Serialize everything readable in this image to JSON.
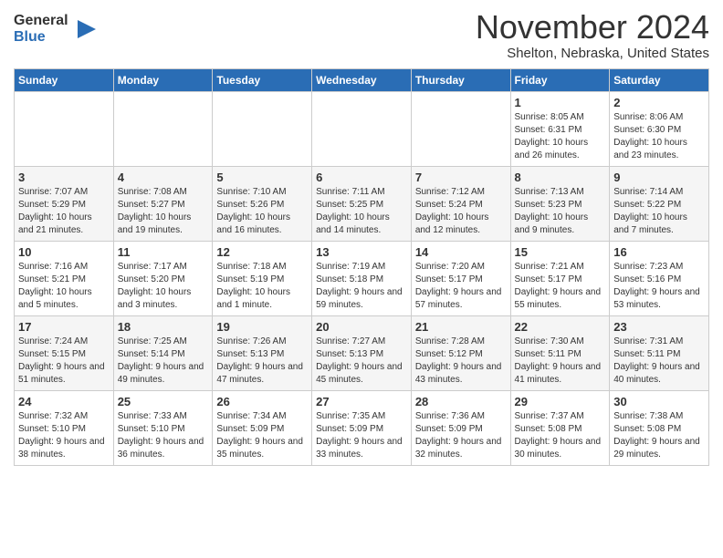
{
  "header": {
    "logo_general": "General",
    "logo_blue": "Blue",
    "month_title": "November 2024",
    "location": "Shelton, Nebraska, United States"
  },
  "days_of_week": [
    "Sunday",
    "Monday",
    "Tuesday",
    "Wednesday",
    "Thursday",
    "Friday",
    "Saturday"
  ],
  "weeks": [
    [
      {
        "day": "",
        "info": ""
      },
      {
        "day": "",
        "info": ""
      },
      {
        "day": "",
        "info": ""
      },
      {
        "day": "",
        "info": ""
      },
      {
        "day": "",
        "info": ""
      },
      {
        "day": "1",
        "info": "Sunrise: 8:05 AM\nSunset: 6:31 PM\nDaylight: 10 hours and 26 minutes."
      },
      {
        "day": "2",
        "info": "Sunrise: 8:06 AM\nSunset: 6:30 PM\nDaylight: 10 hours and 23 minutes."
      }
    ],
    [
      {
        "day": "3",
        "info": "Sunrise: 7:07 AM\nSunset: 5:29 PM\nDaylight: 10 hours and 21 minutes."
      },
      {
        "day": "4",
        "info": "Sunrise: 7:08 AM\nSunset: 5:27 PM\nDaylight: 10 hours and 19 minutes."
      },
      {
        "day": "5",
        "info": "Sunrise: 7:10 AM\nSunset: 5:26 PM\nDaylight: 10 hours and 16 minutes."
      },
      {
        "day": "6",
        "info": "Sunrise: 7:11 AM\nSunset: 5:25 PM\nDaylight: 10 hours and 14 minutes."
      },
      {
        "day": "7",
        "info": "Sunrise: 7:12 AM\nSunset: 5:24 PM\nDaylight: 10 hours and 12 minutes."
      },
      {
        "day": "8",
        "info": "Sunrise: 7:13 AM\nSunset: 5:23 PM\nDaylight: 10 hours and 9 minutes."
      },
      {
        "day": "9",
        "info": "Sunrise: 7:14 AM\nSunset: 5:22 PM\nDaylight: 10 hours and 7 minutes."
      }
    ],
    [
      {
        "day": "10",
        "info": "Sunrise: 7:16 AM\nSunset: 5:21 PM\nDaylight: 10 hours and 5 minutes."
      },
      {
        "day": "11",
        "info": "Sunrise: 7:17 AM\nSunset: 5:20 PM\nDaylight: 10 hours and 3 minutes."
      },
      {
        "day": "12",
        "info": "Sunrise: 7:18 AM\nSunset: 5:19 PM\nDaylight: 10 hours and 1 minute."
      },
      {
        "day": "13",
        "info": "Sunrise: 7:19 AM\nSunset: 5:18 PM\nDaylight: 9 hours and 59 minutes."
      },
      {
        "day": "14",
        "info": "Sunrise: 7:20 AM\nSunset: 5:17 PM\nDaylight: 9 hours and 57 minutes."
      },
      {
        "day": "15",
        "info": "Sunrise: 7:21 AM\nSunset: 5:17 PM\nDaylight: 9 hours and 55 minutes."
      },
      {
        "day": "16",
        "info": "Sunrise: 7:23 AM\nSunset: 5:16 PM\nDaylight: 9 hours and 53 minutes."
      }
    ],
    [
      {
        "day": "17",
        "info": "Sunrise: 7:24 AM\nSunset: 5:15 PM\nDaylight: 9 hours and 51 minutes."
      },
      {
        "day": "18",
        "info": "Sunrise: 7:25 AM\nSunset: 5:14 PM\nDaylight: 9 hours and 49 minutes."
      },
      {
        "day": "19",
        "info": "Sunrise: 7:26 AM\nSunset: 5:13 PM\nDaylight: 9 hours and 47 minutes."
      },
      {
        "day": "20",
        "info": "Sunrise: 7:27 AM\nSunset: 5:13 PM\nDaylight: 9 hours and 45 minutes."
      },
      {
        "day": "21",
        "info": "Sunrise: 7:28 AM\nSunset: 5:12 PM\nDaylight: 9 hours and 43 minutes."
      },
      {
        "day": "22",
        "info": "Sunrise: 7:30 AM\nSunset: 5:11 PM\nDaylight: 9 hours and 41 minutes."
      },
      {
        "day": "23",
        "info": "Sunrise: 7:31 AM\nSunset: 5:11 PM\nDaylight: 9 hours and 40 minutes."
      }
    ],
    [
      {
        "day": "24",
        "info": "Sunrise: 7:32 AM\nSunset: 5:10 PM\nDaylight: 9 hours and 38 minutes."
      },
      {
        "day": "25",
        "info": "Sunrise: 7:33 AM\nSunset: 5:10 PM\nDaylight: 9 hours and 36 minutes."
      },
      {
        "day": "26",
        "info": "Sunrise: 7:34 AM\nSunset: 5:09 PM\nDaylight: 9 hours and 35 minutes."
      },
      {
        "day": "27",
        "info": "Sunrise: 7:35 AM\nSunset: 5:09 PM\nDaylight: 9 hours and 33 minutes."
      },
      {
        "day": "28",
        "info": "Sunrise: 7:36 AM\nSunset: 5:09 PM\nDaylight: 9 hours and 32 minutes."
      },
      {
        "day": "29",
        "info": "Sunrise: 7:37 AM\nSunset: 5:08 PM\nDaylight: 9 hours and 30 minutes."
      },
      {
        "day": "30",
        "info": "Sunrise: 7:38 AM\nSunset: 5:08 PM\nDaylight: 9 hours and 29 minutes."
      }
    ]
  ]
}
